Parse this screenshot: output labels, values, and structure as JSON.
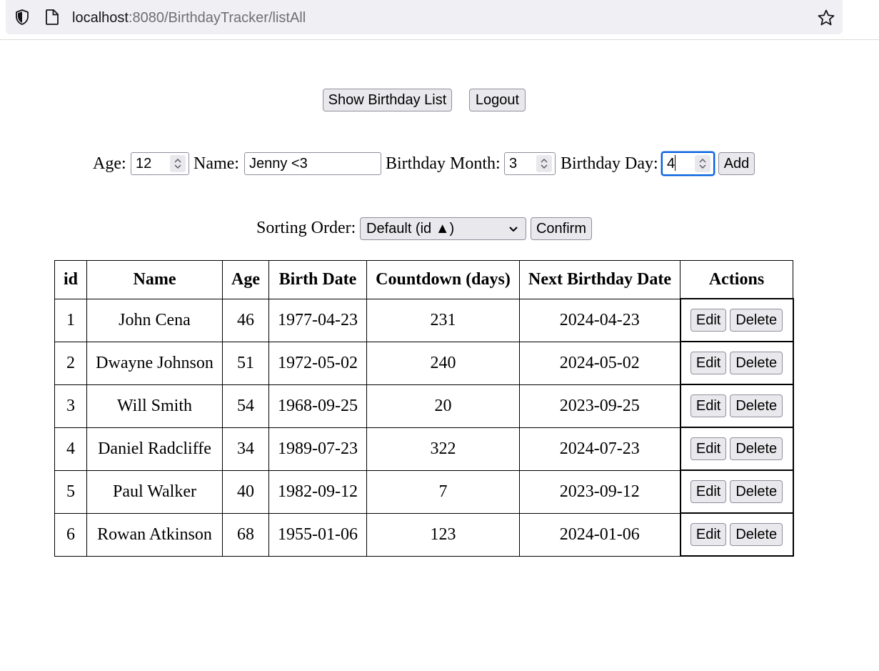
{
  "browser": {
    "url_host": "localhost",
    "url_rest": ":8080/BirthdayTracker/listAll"
  },
  "nav": {
    "show_list_label": "Show Birthday List",
    "logout_label": "Logout"
  },
  "add_form": {
    "age_label": "Age:",
    "age_value": "12",
    "name_label": "Name:",
    "name_value": "Jenny <3",
    "month_label": "Birthday Month:",
    "month_value": "3",
    "day_label": "Birthday Day:",
    "day_value": "4",
    "add_label": "Add"
  },
  "sort": {
    "label": "Sorting Order:",
    "selected": "Default (id ▲)",
    "confirm_label": "Confirm"
  },
  "table": {
    "headers": [
      "id",
      "Name",
      "Age",
      "Birth Date",
      "Countdown (days)",
      "Next Birthday Date",
      "Actions"
    ],
    "edit_label": "Edit",
    "delete_label": "Delete",
    "rows": [
      {
        "id": "1",
        "name": "John Cena",
        "age": "46",
        "birth_date": "1977-04-23",
        "countdown": "231",
        "next_birthday": "2024-04-23"
      },
      {
        "id": "2",
        "name": "Dwayne Johnson",
        "age": "51",
        "birth_date": "1972-05-02",
        "countdown": "240",
        "next_birthday": "2024-05-02"
      },
      {
        "id": "3",
        "name": "Will Smith",
        "age": "54",
        "birth_date": "1968-09-25",
        "countdown": "20",
        "next_birthday": "2023-09-25"
      },
      {
        "id": "4",
        "name": "Daniel Radcliffe",
        "age": "34",
        "birth_date": "1989-07-23",
        "countdown": "322",
        "next_birthday": "2024-07-23"
      },
      {
        "id": "5",
        "name": "Paul Walker",
        "age": "40",
        "birth_date": "1982-09-12",
        "countdown": "7",
        "next_birthday": "2023-09-12"
      },
      {
        "id": "6",
        "name": "Rowan Atkinson",
        "age": "68",
        "birth_date": "1955-01-06",
        "countdown": "123",
        "next_birthday": "2024-01-06"
      }
    ]
  },
  "colors": {
    "button_bg": "#e9e9ed",
    "focus_ring": "#0060df",
    "url_bar_bg": "#f0f0f4"
  }
}
